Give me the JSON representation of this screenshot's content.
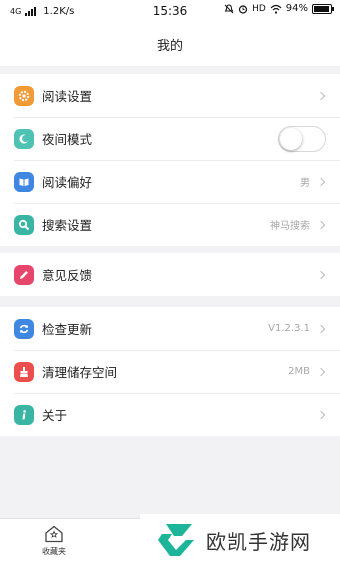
{
  "status_bar": {
    "network": "4G",
    "speed": "1.2K/s",
    "time": "15:36",
    "hd": "HD",
    "battery": "94%"
  },
  "header": {
    "title": "我的"
  },
  "groups": [
    {
      "items": [
        {
          "label": "阅读设置",
          "value": "",
          "icon": "gear-icon",
          "color": "#f29a36"
        },
        {
          "label": "夜间模式",
          "value": "",
          "icon": "moon-icon",
          "color": "#4ec3b3",
          "toggle_on": false
        },
        {
          "label": "阅读偏好",
          "value": "男",
          "icon": "book-icon",
          "color": "#3f87e0"
        },
        {
          "label": "搜索设置",
          "value": "神马搜索",
          "icon": "search-icon",
          "color": "#3ab5a3"
        }
      ]
    },
    {
      "items": [
        {
          "label": "意见反馈",
          "value": "",
          "icon": "pencil-icon",
          "color": "#e6466b"
        }
      ]
    },
    {
      "items": [
        {
          "label": "检查更新",
          "value": "V1.2.3.1",
          "icon": "refresh-icon",
          "color": "#3f87e0"
        },
        {
          "label": "清理储存空间",
          "value": "2MB",
          "icon": "broom-icon",
          "color": "#ec4e4e"
        },
        {
          "label": "关于",
          "value": "",
          "icon": "info-icon",
          "color": "#3ab5a3"
        }
      ]
    }
  ],
  "tab_bar": {
    "favorites_label": "收藏夹",
    "favorites_icon": "home-icon"
  },
  "watermark": {
    "text": "欧凯手游网",
    "logo": "logo-icon",
    "color": "#1db59a"
  }
}
